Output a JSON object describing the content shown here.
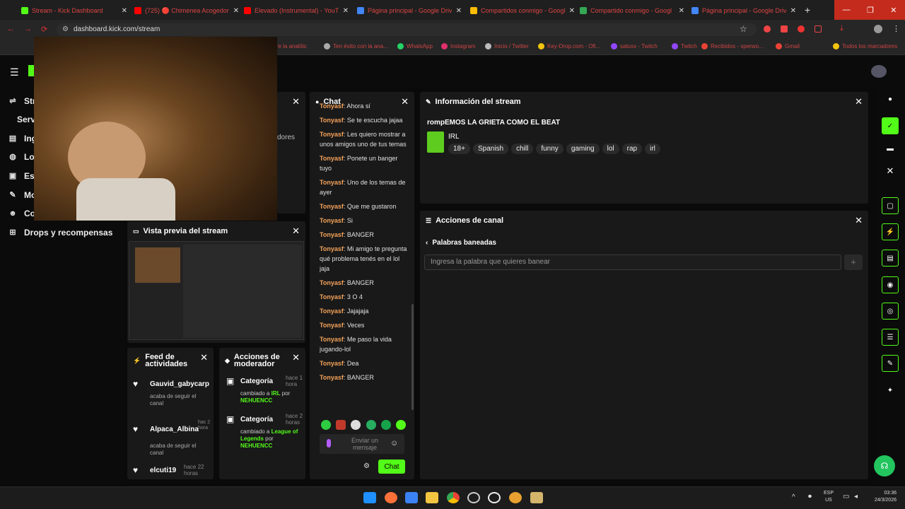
{
  "browser": {
    "tabs": [
      {
        "title": "Stream - Kick Dashboard",
        "color": "#53fc18"
      },
      {
        "title": "(725) 🔴 Chimenea Acogedora",
        "color": "#ff0000"
      },
      {
        "title": "Elevado (Instrumental) - YouTu",
        "color": "#ff0000"
      },
      {
        "title": "Página principal - Google Drive",
        "color": "#4285f4"
      },
      {
        "title": "Compartidos conmigo - Googl",
        "color": "#fbbc04"
      },
      {
        "title": "Compartido conmigo - Googl",
        "color": "#34a853"
      },
      {
        "title": "Página principal - Google Drive",
        "color": "#4285f4"
      }
    ],
    "url": "dashboard.kick.com/stream",
    "bookmarks": [
      {
        "label": "ire la analític",
        "color": "#888"
      },
      {
        "label": "Ten éxito con la ana...",
        "color": "#aaa"
      },
      {
        "label": "WhatsApp",
        "color": "#25d366"
      },
      {
        "label": "Instagram",
        "color": "#e1306c"
      },
      {
        "label": "Inicio / Twitter",
        "color": "#bbb"
      },
      {
        "label": "Key-Drop.com - Ofi...",
        "color": "#f1c40f"
      },
      {
        "label": "satuxx - Twitch",
        "color": "#9146ff"
      },
      {
        "label": "Twitch",
        "color": "#9146ff"
      },
      {
        "label": "Recibidos - xperwo...",
        "color": "#ea4335"
      },
      {
        "label": "Gmail",
        "color": "#ea4335"
      },
      {
        "label": "Todos los marcadores",
        "color": "#f1c40f"
      }
    ]
  },
  "sidebar": {
    "items": [
      {
        "label": "Str"
      },
      {
        "label": "Serv"
      },
      {
        "label": "Ing"
      },
      {
        "label": "Loc"
      },
      {
        "label": "Est"
      },
      {
        "label": "Mo"
      },
      {
        "label": "Co"
      },
      {
        "label": "Drops y recompensas"
      }
    ]
  },
  "partial_panel": {
    "text": "dores"
  },
  "preview": {
    "title": "Vista previa del stream"
  },
  "feed": {
    "title": "Feed de actividades",
    "items": [
      {
        "user": "Gauvid_gabycarp",
        "action": "acaba de seguir el canal",
        "time": ""
      },
      {
        "user": "Alpaca_Albina",
        "action": "acaba de seguir el canal",
        "time": "hac 2 hora"
      },
      {
        "user": "elcuti19",
        "action": "",
        "time": "hace 22 horas"
      }
    ]
  },
  "modactions": {
    "title": "Acciones de moderador",
    "items": [
      {
        "title": "Categoría",
        "time": "hace 1 hora",
        "desc1": "cambiado a ",
        "cat": "IRL",
        "desc2": " por",
        "user": "NEHUENCC"
      },
      {
        "title": "Categoría",
        "time": "hace 2 horas",
        "desc1": "cambiado a ",
        "cat": "League of Legends",
        "desc2": " por",
        "user": "NEHUENCC"
      }
    ]
  },
  "chat": {
    "title": "Chat",
    "messages": [
      {
        "user": "Tonyasf",
        "text": "Ahora sí"
      },
      {
        "user": "Tonyasf",
        "text": "Se te escucha jajaa"
      },
      {
        "user": "Tonyasf",
        "text": "Les quiero mostrar a unos amigos uno de tus temas"
      },
      {
        "user": "Tonyasf",
        "text": "Ponete un banger tuyo"
      },
      {
        "user": "Tonyasf",
        "text": "Uno de los temas de ayer"
      },
      {
        "user": "Tonyasf",
        "text": "Que me gustaron"
      },
      {
        "user": "Tonyasf",
        "text": "Si"
      },
      {
        "user": "Tonyasf",
        "text": "BANGER"
      },
      {
        "user": "Tonyasf",
        "text": "Mi amigo te pregunta qué problema tenés en el lol jaja"
      },
      {
        "user": "Tonyasf",
        "text": "BANGER"
      },
      {
        "user": "Tonyasf",
        "text": "3 O 4"
      },
      {
        "user": "Tonyasf",
        "text": "Jajajaja"
      },
      {
        "user": "Tonyasf",
        "text": "Veces"
      },
      {
        "user": "Tonyasf",
        "text": "Me paso la vida jugando-lol"
      },
      {
        "user": "Tonyasf",
        "text": "Dea"
      },
      {
        "user": "Tonyasf",
        "text": "BANGER"
      }
    ],
    "input_placeholder": "Enviar un mensaje",
    "send_label": "Chat"
  },
  "streaminfo": {
    "panel_title": "Información del stream",
    "title": "rompEMOS LA GRIETA COMO EL BEAT",
    "category": "IRL",
    "tags": [
      "18+",
      "Spanish",
      "chill",
      "funny",
      "gaming",
      "lol",
      "rap",
      "irl"
    ]
  },
  "channelactions": {
    "panel_title": "Acciones de canal",
    "sub_title": "Palabras baneadas",
    "input_placeholder": "Ingresa la palabra que quieres banear"
  },
  "taskbar": {
    "lang": "ESP",
    "region": "US",
    "time": "03:36",
    "date": "24/3/2026"
  }
}
